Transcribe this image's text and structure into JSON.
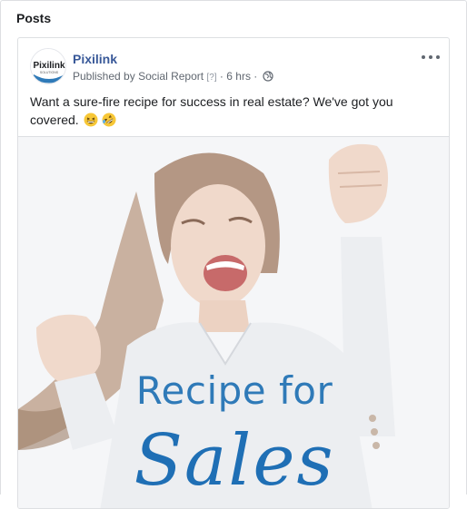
{
  "section": {
    "title": "Posts"
  },
  "post": {
    "page_name": "Pixilink",
    "avatar_text": "Pixilink",
    "avatar_subtext": "SOLUTIONS",
    "published_prefix": "Published by",
    "publisher": "Social Report",
    "help_marker": "[?]",
    "separator": "·",
    "time": "6 hrs",
    "text": "Want a sure-fire recipe for success in real estate? We've got you covered.",
    "emojis": [
      "grinning-squinting-face",
      "rolling-on-floor-laughing"
    ],
    "image": {
      "headline": "Recipe for",
      "script_text": "Sales"
    }
  },
  "colors": {
    "brand_link": "#385898",
    "meta_text": "#606770",
    "image_headline": "#2f7ab8",
    "image_script": "#1f6fb5"
  }
}
